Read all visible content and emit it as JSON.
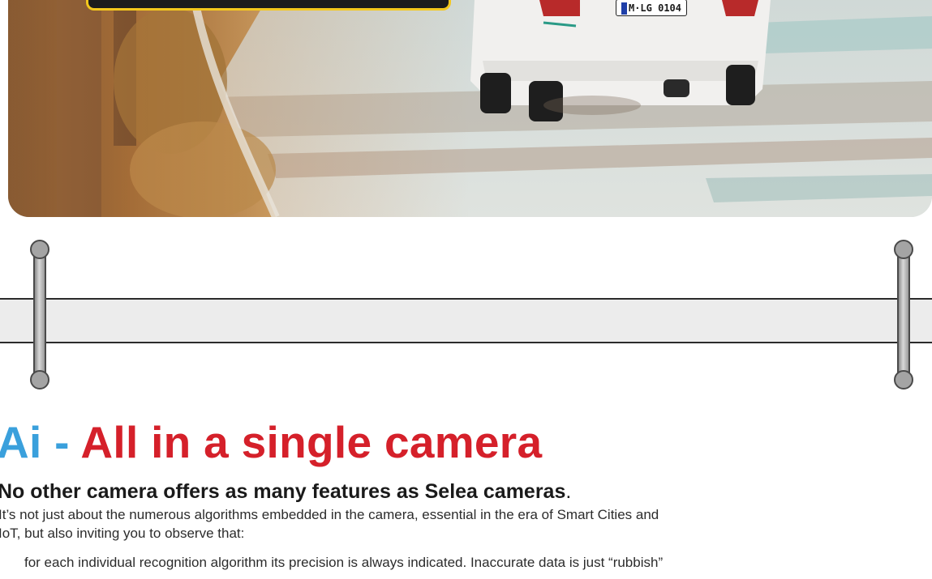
{
  "hero": {
    "license_plate": "M·LG 0104"
  },
  "section": {
    "headline_brand": "Ai -",
    "headline_rest": "All in a single camera",
    "subheading": "No other camera offers as many features as Selea cameras",
    "subheading_period": ".",
    "intro_line1": "It’s not just about the numerous algorithms embedded in the camera, essential in the era of Smart Cities and",
    "intro_line2": "IoT, but also inviting you to observe that:",
    "bullet_1": "for each individual recognition algorithm its precision is always indicated. Inaccurate data is just “rubbish”"
  },
  "colors": {
    "brand_blue": "#3aa0dc",
    "headline_red": "#d5202a",
    "callout_yellow": "#f4c81d"
  }
}
